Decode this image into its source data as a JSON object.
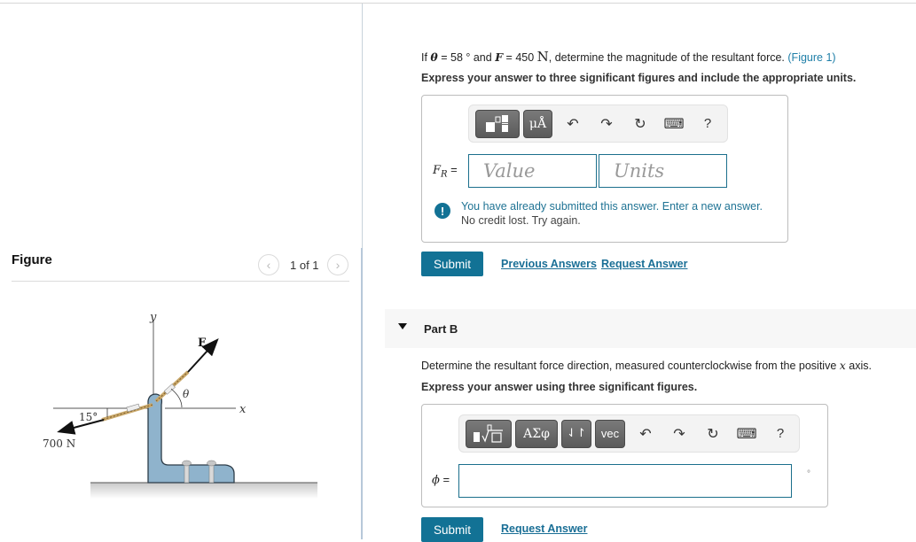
{
  "figure_panel": {
    "title": "Figure",
    "pager": {
      "prev_icon": "‹",
      "text": "1 of 1",
      "next_icon": "›"
    },
    "diagram": {
      "labels": {
        "y_axis": "y",
        "x_axis": "x",
        "force": "F",
        "theta": "θ",
        "angle": "15°",
        "load": "700 N"
      }
    }
  },
  "part_a": {
    "question": {
      "prefix": "If ",
      "theta_symbol": "θ",
      "theta_eq": " = 58 ° and ",
      "f_symbol": "F",
      "f_eq": " = 450 ",
      "f_unit": "N",
      "suffix": ", determine the magnitude of the resultant force. ",
      "figure_link": "(Figure 1)"
    },
    "instruction": "Express your answer to three significant figures and include the appropriate units.",
    "toolbar": {
      "templates_icon": "templates",
      "units_label": "μÅ",
      "undo_icon": "↶",
      "redo_icon": "↷",
      "reset_icon": "↻",
      "keyboard_icon": "⌨",
      "help_label": "?"
    },
    "answer_label": "F",
    "answer_label_sub": "R",
    "answer_eq": " =",
    "value_placeholder": "Value",
    "units_placeholder": "Units",
    "feedback": {
      "icon": "!",
      "line1": "You have already submitted this answer. Enter a new answer.",
      "line2": "No credit lost. Try again."
    },
    "submit_label": "Submit",
    "previous_answers_label": "Previous Answers",
    "request_answer_label": "Request Answer"
  },
  "part_b": {
    "title": "Part B",
    "question_prefix": "Determine the resultant force direction, measured counterclockwise from the positive ",
    "question_var": "x",
    "question_suffix": " axis.",
    "instruction": "Express your answer using three significant figures.",
    "toolbar": {
      "templates_icon": "radical-templates",
      "greek_label": "ΑΣφ",
      "arrows_label": "⇃↾",
      "vec_label": "vec",
      "undo_icon": "↶",
      "redo_icon": "↷",
      "reset_icon": "↻",
      "keyboard_icon": "⌨",
      "help_label": "?"
    },
    "answer_label": "ϕ",
    "answer_eq": " =",
    "answer_value": "",
    "unit": "°",
    "submit_label": "Submit",
    "request_answer_label": "Request Answer"
  }
}
